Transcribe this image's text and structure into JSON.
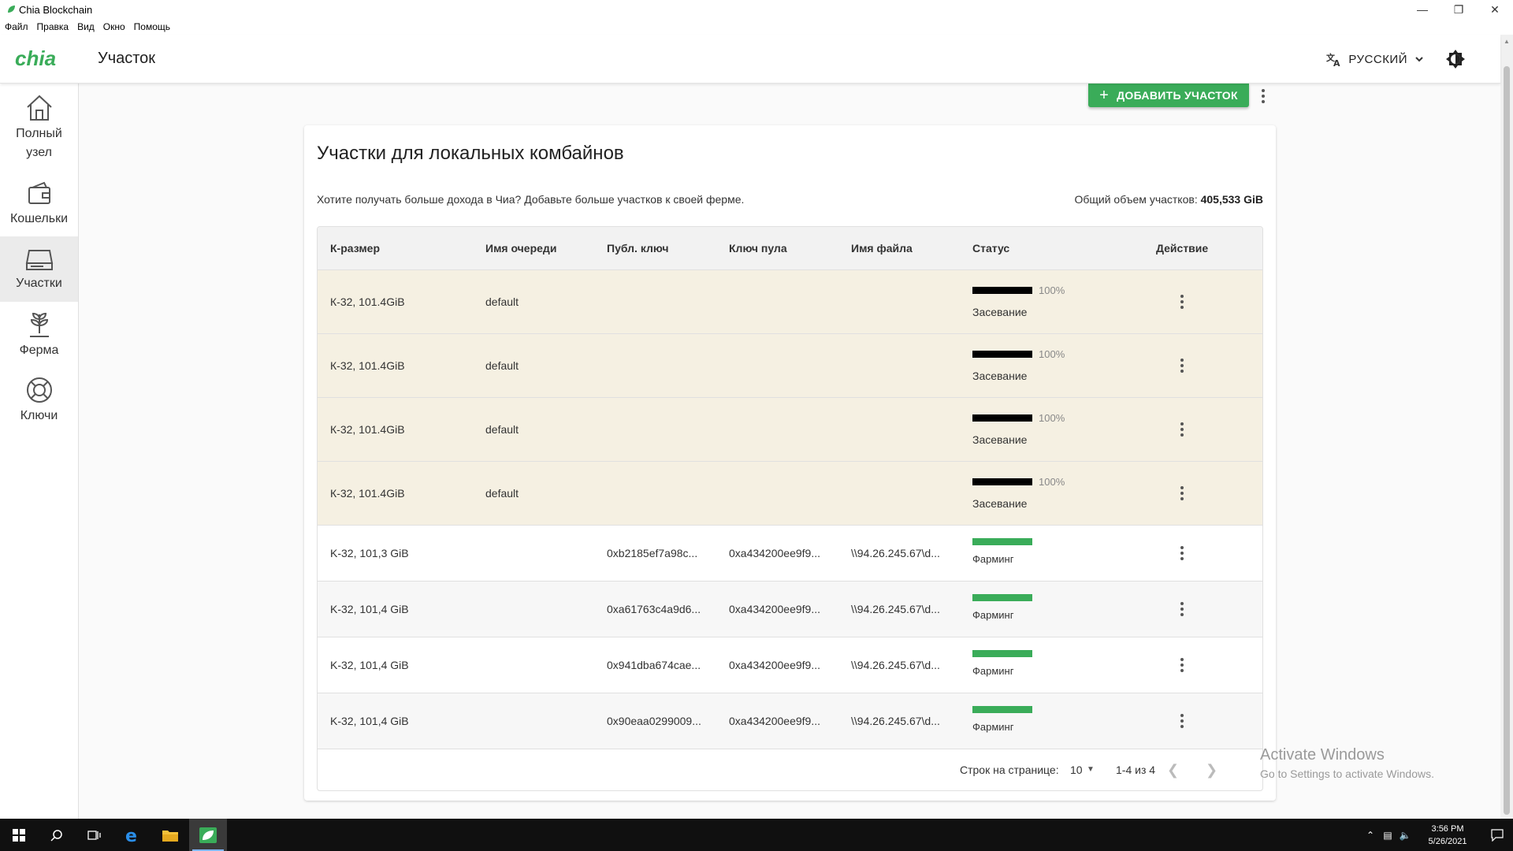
{
  "window": {
    "title": "Chia Blockchain"
  },
  "menu": [
    "Файл",
    "Правка",
    "Вид",
    "Окно",
    "Помощь"
  ],
  "header": {
    "logo_text": "chia",
    "page_title": "Участок",
    "language": "РУССКИЙ"
  },
  "sidebar": {
    "items": [
      {
        "label": "Полный узел",
        "icon": "home-icon"
      },
      {
        "label": "Кошельки",
        "icon": "wallet-icon"
      },
      {
        "label": "Участки",
        "icon": "storage-icon",
        "active": true
      },
      {
        "label": "Ферма",
        "icon": "sprout-icon"
      },
      {
        "label": "Ключи",
        "icon": "lifebuoy-icon"
      }
    ]
  },
  "actions": {
    "add_plot": "ДОБАВИТЬ УЧАСТОК"
  },
  "card": {
    "title": "Участки для локальных комбайнов",
    "description": "Хотите получать больше дохода в Чиа? Добавьте больше участков к своей ферме.",
    "total_label": "Общий объем участков:",
    "total_value": "405,533 GiB"
  },
  "table": {
    "headers": [
      "К-размер",
      "Имя очереди",
      "Публ. ключ",
      "Ключ пула",
      "Имя файла",
      "Статус",
      "Действие"
    ],
    "queue_rows": [
      {
        "size": "К-32, 101.4GiB",
        "queue": "default",
        "progress_pct": 100,
        "progress_text": "100%",
        "status": "Засевание"
      },
      {
        "size": "К-32, 101.4GiB",
        "queue": "default",
        "progress_pct": 100,
        "progress_text": "100%",
        "status": "Засевание"
      },
      {
        "size": "К-32, 101.4GiB",
        "queue": "default",
        "progress_pct": 100,
        "progress_text": "100%",
        "status": "Засевание"
      },
      {
        "size": "К-32, 101.4GiB",
        "queue": "default",
        "progress_pct": 100,
        "progress_text": "100%",
        "status": "Засевание"
      }
    ],
    "plot_rows": [
      {
        "size": "K-32, 101,3 GiB",
        "pubkey": "0xb2185ef7a98c...",
        "poolkey": "0xa434200ee9f9...",
        "filename": "\\\\94.26.245.67\\d...",
        "status": "Фарминг"
      },
      {
        "size": "K-32, 101,4 GiB",
        "pubkey": "0xa61763c4a9d6...",
        "poolkey": "0xa434200ee9f9...",
        "filename": "\\\\94.26.245.67\\d...",
        "status": "Фарминг"
      },
      {
        "size": "K-32, 101,4 GiB",
        "pubkey": "0x941dba674cae...",
        "poolkey": "0xa434200ee9f9...",
        "filename": "\\\\94.26.245.67\\d...",
        "status": "Фарминг"
      },
      {
        "size": "K-32, 101,4 GiB",
        "pubkey": "0x90eaa0299009...",
        "poolkey": "0xa434200ee9f9...",
        "filename": "\\\\94.26.245.67\\d...",
        "status": "Фарминг"
      }
    ],
    "pagination": {
      "rows_per_page_label": "Строк на странице:",
      "rows_per_page": "10",
      "range": "1-4 из 4"
    }
  },
  "watermark": {
    "line1": "Activate Windows",
    "line2": "Go to Settings to activate Windows."
  },
  "taskbar": {
    "time": "3:56 PM",
    "date": "5/26/2021"
  },
  "colors": {
    "accent": "#3aac59",
    "queue_row_bg": "#f5f0e2",
    "progress_seeding": "#000000"
  }
}
